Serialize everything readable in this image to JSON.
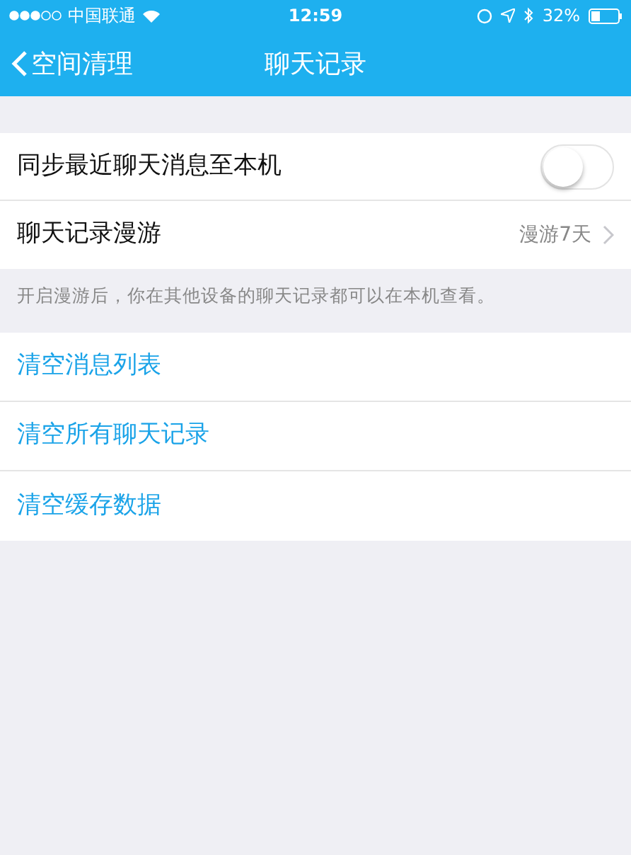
{
  "status_bar": {
    "carrier": "中国联通",
    "time": "12:59",
    "battery": "32%"
  },
  "nav": {
    "back": "空间清理",
    "title": "聊天记录"
  },
  "settings": [
    {
      "kind": "toggle",
      "label": "同步最近聊天消息至本机",
      "on": false
    },
    {
      "kind": "link",
      "label": "聊天记录漫游",
      "value": "漫游7天"
    }
  ],
  "note": "开启漫游后，你在其他设备的聊天记录都可以在本机查看。",
  "actions": [
    "清空消息列表",
    "清空所有聊天记录",
    "清空缓存数据"
  ]
}
